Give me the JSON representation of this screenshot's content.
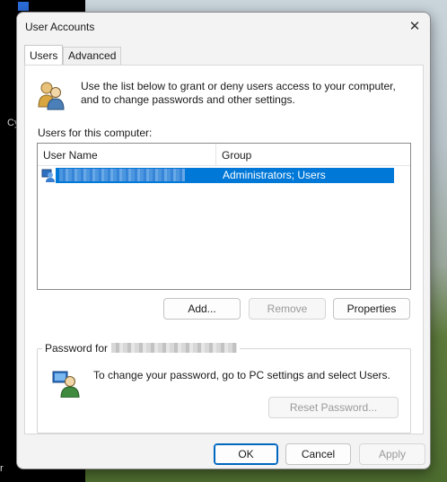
{
  "window": {
    "title": "User Accounts",
    "close_glyph": "✕"
  },
  "tabs": [
    {
      "label": "Users",
      "active": true
    },
    {
      "label": "Advanced",
      "active": false
    }
  ],
  "intro": {
    "icon": "users-icon",
    "text": "Use the list below to grant or deny users access to your computer, and to change passwords and other settings."
  },
  "users_label": "Users for this computer:",
  "table": {
    "columns": [
      "User Name",
      "Group"
    ],
    "rows": [
      {
        "group": "Administrators; Users",
        "selected": true
      }
    ]
  },
  "buttons": {
    "add": "Add...",
    "remove": "Remove",
    "properties": "Properties",
    "reset_password": "Reset Password...",
    "ok": "OK",
    "cancel": "Cancel",
    "apply": "Apply"
  },
  "password_group": {
    "legend": "Password for",
    "text": "To change your password, go to PC settings and select Users.",
    "icon": "user-key-icon"
  },
  "colors": {
    "selection": "#0078d7",
    "accent": "#0067c0"
  }
}
